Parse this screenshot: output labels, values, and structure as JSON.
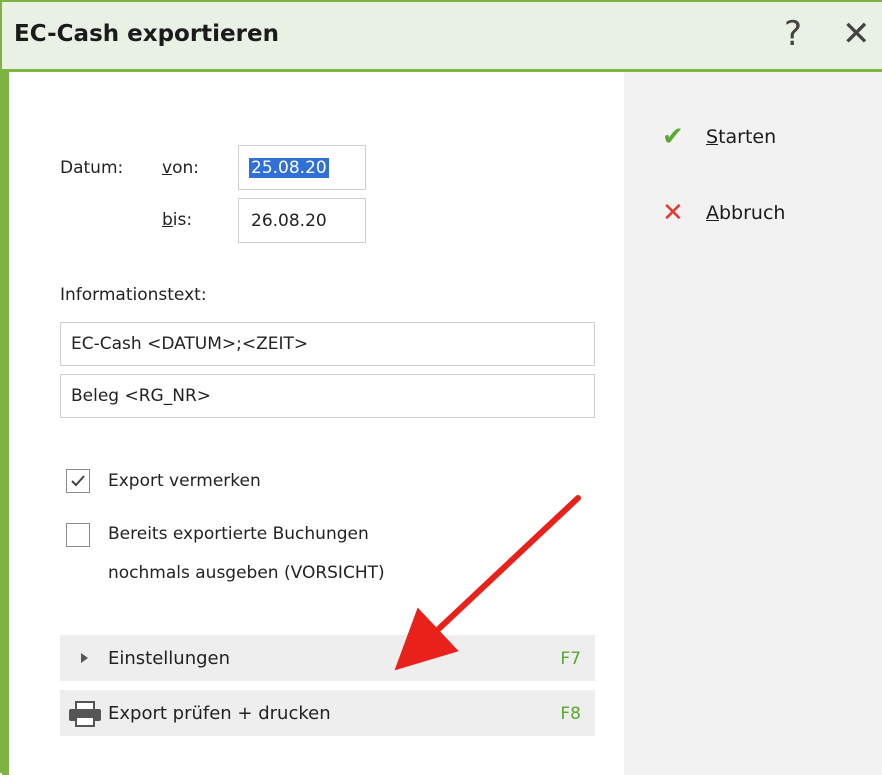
{
  "window": {
    "title": "EC-Cash exportieren",
    "help_glyph": "?",
    "close_glyph": "✕"
  },
  "date": {
    "label": "Datum:",
    "from_label_underlined": "v",
    "from_label_rest": "on:",
    "from_value": "25.08.20",
    "to_label_underlined": "b",
    "to_label_rest": "is:",
    "to_value": "26.08.20"
  },
  "info": {
    "label": "Informationstext:",
    "line1": "EC-Cash <DATUM>;<ZEIT>",
    "line2": "Beleg <RG_NR>"
  },
  "options": {
    "mark_export": {
      "label": "Export vermerken",
      "checked": true
    },
    "re_export": {
      "label_line1": "Bereits exportierte Buchungen",
      "label_line2": "nochmals ausgeben (VORSICHT)",
      "checked": false
    }
  },
  "sections": {
    "settings": {
      "label": "Einstellungen",
      "key": "F7"
    },
    "print": {
      "label": "Export prüfen + drucken",
      "key": "F8"
    }
  },
  "actions": {
    "start_underlined": "S",
    "start_rest": "tarten",
    "abort_underlined": "A",
    "abort_rest": "bbruch"
  },
  "colors": {
    "accent_green": "#7cb342",
    "key_green": "#5aa832",
    "abort_red": "#e53935",
    "selection_blue": "#2f6fd6",
    "annotation_arrow": "#e8211a"
  },
  "icons": [
    "help-icon",
    "close-icon",
    "check-icon",
    "x-icon",
    "checkbox-icon",
    "triangle-right-icon",
    "printer-icon",
    "annotation-arrow-icon"
  ]
}
